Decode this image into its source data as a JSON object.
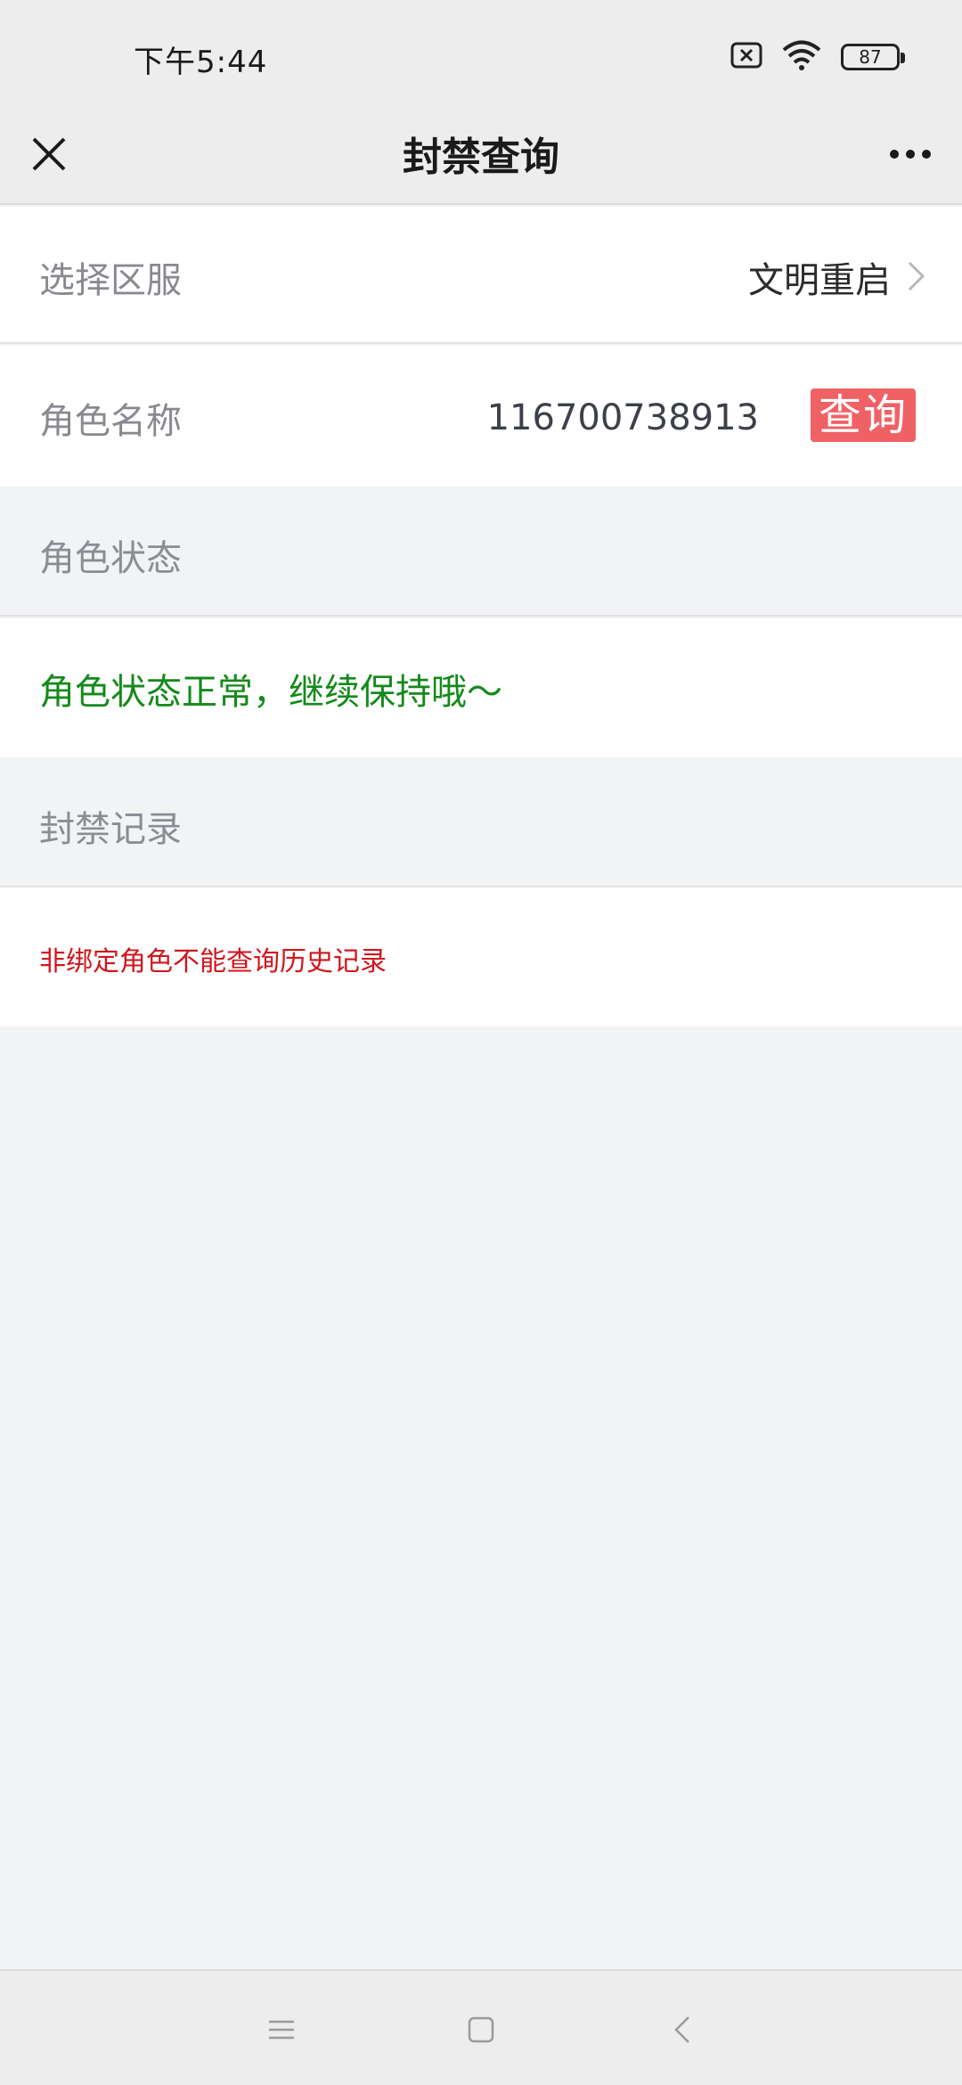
{
  "status_bar": {
    "time": "下午5:44",
    "battery": "87"
  },
  "nav": {
    "title": "封禁查询"
  },
  "server": {
    "label": "选择区服",
    "value": "文明重启"
  },
  "role": {
    "label": "角色名称",
    "value": "116700738913",
    "query_button": "查询"
  },
  "role_status": {
    "header": "角色状态",
    "message": "角色状态正常，继续保持哦～"
  },
  "ban_record": {
    "header": "封禁记录",
    "message": "非绑定角色不能查询历史记录"
  },
  "colors": {
    "status_ok": "#148a1a",
    "warning": "#d0161c",
    "query_button": "#ef6165"
  },
  "icons": [
    "close-icon",
    "more-icon",
    "chevron-right-icon",
    "wifi-icon",
    "sim-off-icon",
    "battery-icon",
    "menu-icon",
    "home-icon",
    "back-icon"
  ]
}
